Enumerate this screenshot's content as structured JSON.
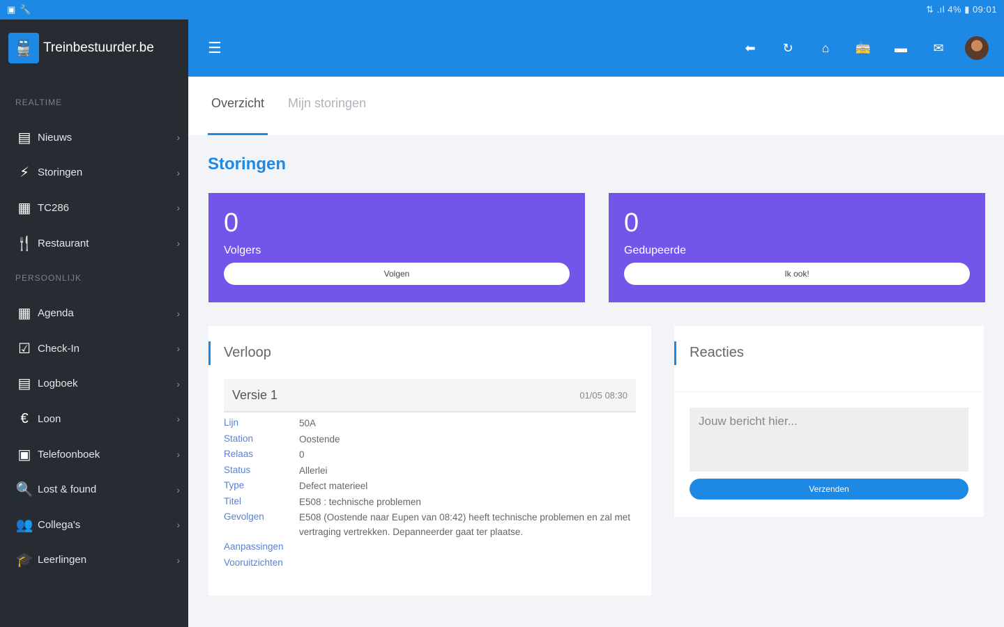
{
  "statusbar": {
    "left_icons": [
      "▣",
      "🔧"
    ],
    "right_text": "⇅ .ıl 4% ▮ 09:01"
  },
  "brand": {
    "title": "Treinbestuurder.be",
    "logo_glyph": "🚆"
  },
  "sidebar": {
    "section_realtime": "REALTIME",
    "section_personal": "PERSOONLIJK",
    "realtime_items": [
      {
        "label": "Nieuws",
        "icon": "newspaper-icon",
        "glyph": "▤"
      },
      {
        "label": "Storingen",
        "icon": "lightning-icon",
        "glyph": "⚡"
      },
      {
        "label": "TC286",
        "icon": "calculator-icon",
        "glyph": "▦"
      },
      {
        "label": "Restaurant",
        "icon": "cutlery-icon",
        "glyph": "🍴"
      }
    ],
    "personal_items": [
      {
        "label": "Agenda",
        "icon": "calendar-icon",
        "glyph": "▦"
      },
      {
        "label": "Check-In",
        "icon": "checkbox-icon",
        "glyph": "☑"
      },
      {
        "label": "Logboek",
        "icon": "book-icon",
        "glyph": "▤"
      },
      {
        "label": "Loon",
        "icon": "euro-icon",
        "glyph": "€"
      },
      {
        "label": "Telefoonboek",
        "icon": "contact-book-icon",
        "glyph": "▣"
      },
      {
        "label": "Lost & found",
        "icon": "search-icon",
        "glyph": "🔍"
      },
      {
        "label": "Collega's",
        "icon": "users-icon",
        "glyph": "👥"
      },
      {
        "label": "Leerlingen",
        "icon": "graduation-cap-icon",
        "glyph": "🎓"
      }
    ],
    "chevron": "›"
  },
  "topbar": {
    "menu_glyph": "☰",
    "actions": [
      {
        "icon": "back-arrow-icon",
        "glyph": "⬅"
      },
      {
        "icon": "refresh-icon",
        "glyph": "↻"
      },
      {
        "icon": "home-icon",
        "glyph": "⌂"
      },
      {
        "icon": "train-icon",
        "glyph": "🚋"
      },
      {
        "icon": "chat-icon",
        "glyph": "▬"
      },
      {
        "icon": "mail-icon",
        "glyph": "✉"
      }
    ]
  },
  "tabs": {
    "overview": "Overzicht",
    "my_disruptions": "Mijn storingen"
  },
  "page": {
    "title": "Storingen"
  },
  "stats": {
    "followers": {
      "value": "0",
      "label": "Volgers",
      "button": "Volgen"
    },
    "affected": {
      "value": "0",
      "label": "Gedupeerde",
      "button": "Ik ook!"
    }
  },
  "verloop": {
    "title": "Verloop",
    "version_title": "Versie 1",
    "version_date": "01/05 08:30",
    "rows": [
      {
        "key": "Lijn",
        "value": "50A"
      },
      {
        "key": "Station",
        "value": "Oostende"
      },
      {
        "key": "Relaas",
        "value": "0"
      },
      {
        "key": "Status",
        "value": "Allerlei"
      },
      {
        "key": "Type",
        "value": "Defect materieel"
      },
      {
        "key": "Titel",
        "value": "E508 : technische problemen"
      },
      {
        "key": "Gevolgen",
        "value": "E508 (Oostende naar Eupen van 08:42) heeft technische problemen en zal met vertraging vertrekken. Depanneerder gaat ter plaatse."
      }
    ],
    "link_changes": "Aanpassingen",
    "link_forecast": "Vooruitzichten"
  },
  "reacties": {
    "title": "Reacties",
    "placeholder": "Jouw bericht hier...",
    "send": "Verzenden"
  },
  "colors": {
    "primary": "#1e88e5",
    "sidebar": "#272c33",
    "card": "#7355ea"
  }
}
